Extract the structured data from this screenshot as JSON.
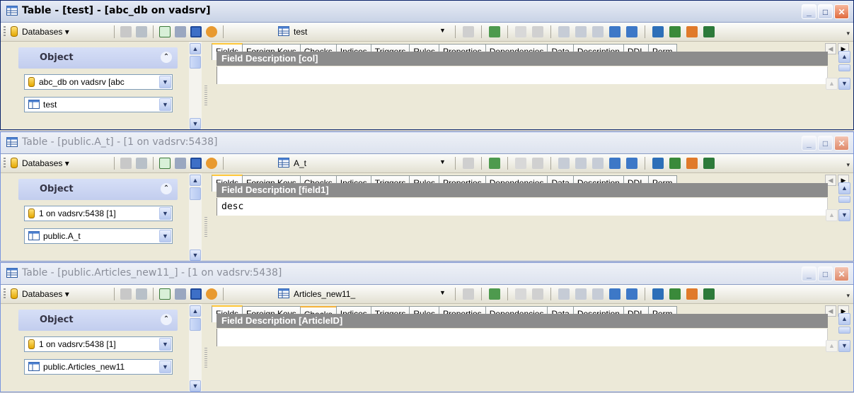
{
  "windows": [
    {
      "title": "Table - [test] - [abc_db on vadsrv]",
      "active": true,
      "toolbar": {
        "databases_label": "Databases",
        "table_name": "test"
      },
      "object_panel": {
        "header": "Object",
        "database": "abc_db on vadsrv [abc",
        "table": "test"
      },
      "tabs": [
        "Fields",
        "Foreign Keys",
        "Checks",
        "Indices",
        "Triggers",
        "Rules",
        "Properties",
        "Dependencies",
        "Data",
        "Description",
        "DDL",
        "Perm"
      ],
      "active_tab": "Fields",
      "field_description": {
        "header": "Field Description [col]",
        "value": ""
      }
    },
    {
      "title": "Table - [public.A_t] - [1 on vadsrv:5438]",
      "active": false,
      "toolbar": {
        "databases_label": "Databases",
        "table_name": "A_t"
      },
      "object_panel": {
        "header": "Object",
        "database": "1 on vadsrv:5438 [1]",
        "table": "public.A_t"
      },
      "tabs": [
        "Fields",
        "Foreign Keys",
        "Checks",
        "Indices",
        "Triggers",
        "Rules",
        "Properties",
        "Dependencies",
        "Data",
        "Description",
        "DDL",
        "Perm"
      ],
      "active_tab": "Fields",
      "field_description": {
        "header": "Field Description [field1]",
        "value": "desc"
      }
    },
    {
      "title": "Table - [public.Articles_new11_] - [1 on vadsrv:5438]",
      "active": false,
      "toolbar": {
        "databases_label": "Databases",
        "table_name": "Articles_new11_"
      },
      "object_panel": {
        "header": "Object",
        "database": "1 on vadsrv:5438 [1]",
        "table": "public.Articles_new11"
      },
      "tabs": [
        "Fields",
        "Foreign Keys",
        "Checks",
        "Indices",
        "Triggers",
        "Rules",
        "Properties",
        "Dependencies",
        "Data",
        "Description",
        "DDL",
        "Perm"
      ],
      "active_tab": "Fields",
      "field_description": {
        "header": "Field Description [ArticleID]",
        "value": ""
      }
    }
  ],
  "colors": {
    "active_title_text": "#000000",
    "inactive_title_text": "#8a8e9a",
    "field_header_bg": "#8c8c8c",
    "tab_hot": "#ffc83c",
    "window_bg": "#ece9d8"
  }
}
